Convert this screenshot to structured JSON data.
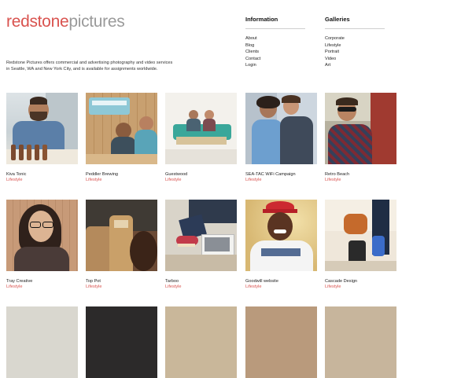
{
  "brand": {
    "part1": "redstone",
    "part2": "pictures"
  },
  "intro": "Redstone Pictures offers commercial and advertising photography and video services in Seattle, WA and New York City, and is available for assignments worldwide.",
  "nav": {
    "information": {
      "heading": "Information",
      "items": [
        "About",
        "Blog",
        "Clients",
        "Contact",
        "Login"
      ]
    },
    "galleries": {
      "heading": "Galleries",
      "items": [
        "Corporate",
        "Lifestyle",
        "Portrait",
        "Video",
        "Art"
      ]
    }
  },
  "tiles": [
    {
      "title": "Kiva Tonic",
      "category": "Lifestyle"
    },
    {
      "title": "Peddler Brewing",
      "category": "Lifestyle"
    },
    {
      "title": "Guestwood",
      "category": "Lifestyle"
    },
    {
      "title": "SEA-TAC WiFi Campaign",
      "category": "Lifestyle"
    },
    {
      "title": "Retro Beach",
      "category": "Lifestyle"
    },
    {
      "title": "Tray Creative",
      "category": "Lifestyle"
    },
    {
      "title": "Top Pot",
      "category": "Lifestyle"
    },
    {
      "title": "Tarboo",
      "category": "Lifestyle"
    },
    {
      "title": "Goodwill website",
      "category": "Lifestyle"
    },
    {
      "title": "Cascade Design",
      "category": "Lifestyle"
    }
  ]
}
